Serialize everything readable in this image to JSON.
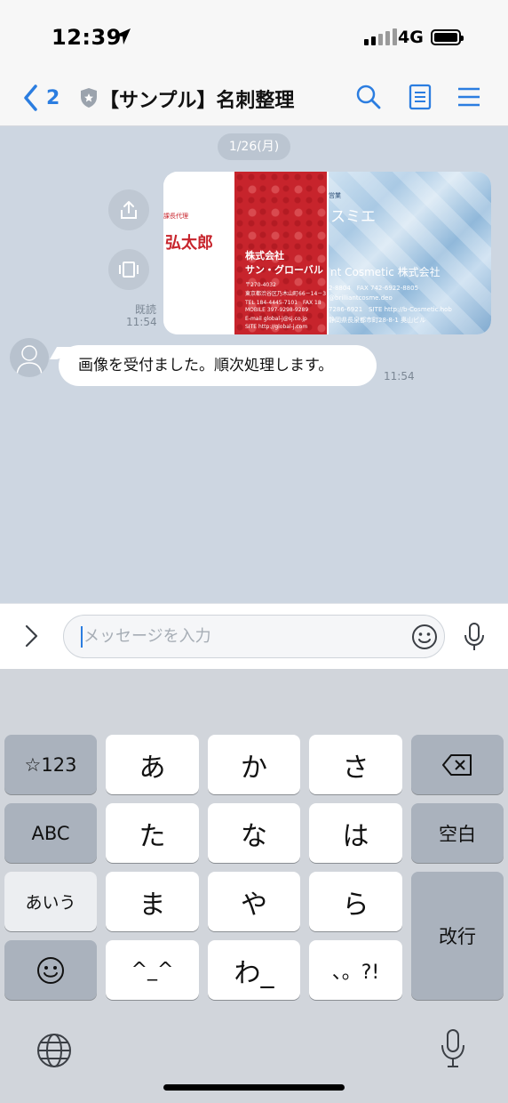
{
  "status_bar": {
    "time": "12:39",
    "network": "4G"
  },
  "header": {
    "back_count": "2",
    "title": "【サンプル】名刺整理",
    "icons": [
      "search-icon",
      "notes-icon",
      "menu-icon"
    ],
    "accent_color": "#2b7de0"
  },
  "chat": {
    "date": "1/26(月)",
    "sent": {
      "read_label": "既読",
      "time": "11:54",
      "card1": {
        "role": "課長代理",
        "name": "弘太郎",
        "company_line1": "株式会社",
        "company_line2": "サン・グローバル",
        "postal": "〒270-4032",
        "address": "東京都渋谷区乃木山町66－14－3",
        "tel": "TEL 184-4445-7101　FAX 18",
        "mobile": "MOBILE 397-9298-9289",
        "email": "E-mail global-j@sj.co.jp",
        "site": "SITE http://global-j.com"
      },
      "card2": {
        "role": "営業",
        "name": "スミエ",
        "company": "nt Cosmetic 株式会社",
        "line1": "2-8804　FAX 742-6922-8805",
        "line2": "@brilliantcosme.deo",
        "line3": "7286-6921　SITE http://b-Cosmetic.hob",
        "line4": "静岡県長泉都市町28-8-1 奥山ビル"
      }
    },
    "received": {
      "text": "画像を受付ました。順次処理します。",
      "time": "11:54"
    }
  },
  "input": {
    "placeholder": "メッセージを入力"
  },
  "keyboard": {
    "rows": [
      [
        "☆123",
        "あ",
        "か",
        "さ"
      ],
      [
        "ABC",
        "た",
        "な",
        "は",
        "空白"
      ],
      [
        "あいう",
        "ま",
        "や",
        "ら",
        "改行"
      ],
      [
        "^_^",
        "わ_",
        "、。?!"
      ]
    ],
    "k_sym": "☆123",
    "k_a": "あ",
    "k_ka": "か",
    "k_sa": "さ",
    "k_abc": "ABC",
    "k_ta": "た",
    "k_na": "な",
    "k_ha": "は",
    "k_space": "空白",
    "k_aiu": "あいう",
    "k_ma": "ま",
    "k_ya": "や",
    "k_ra": "ら",
    "k_return": "改行",
    "k_face": "^_^",
    "k_wa": "わ_",
    "k_punct": "、。?!"
  }
}
